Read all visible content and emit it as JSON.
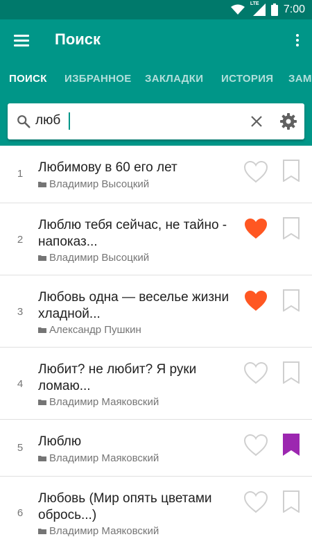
{
  "status_bar": {
    "time": "7:00",
    "network_label": "LTE"
  },
  "app_bar": {
    "title": "Поиск"
  },
  "tabs": [
    {
      "label": "ПОИСК",
      "active": true
    },
    {
      "label": "ИЗБРАННОЕ",
      "active": false
    },
    {
      "label": "ЗАКЛАДКИ",
      "active": false
    },
    {
      "label": "ИСТОРИЯ",
      "active": false
    },
    {
      "label": "ЗАМ",
      "active": false
    }
  ],
  "search": {
    "value": "люб"
  },
  "results": [
    {
      "number": "1",
      "title": "Любимову в 60 его лет",
      "author": "Владимир Высоцкий",
      "favorite": false,
      "bookmarked": false
    },
    {
      "number": "2",
      "title": "Люблю тебя сейчас, не тайно - напоказ...",
      "author": "Владимир Высоцкий",
      "favorite": true,
      "bookmarked": false
    },
    {
      "number": "3",
      "title": "Любовь одна — веселье жизни хладной...",
      "author": "Александр Пушкин",
      "favorite": true,
      "bookmarked": false
    },
    {
      "number": "4",
      "title": "Любит? не любит? Я руки ломаю...",
      "author": "Владимир Маяковский",
      "favorite": false,
      "bookmarked": false
    },
    {
      "number": "5",
      "title": "Люблю",
      "author": "Владимир Маяковский",
      "favorite": false,
      "bookmarked": true
    },
    {
      "number": "6",
      "title": "Любовь (Мир опять цветами обрось...)",
      "author": "Владимир Маяковский",
      "favorite": false,
      "bookmarked": false
    }
  ],
  "colors": {
    "primary": "#009688",
    "primary_dark": "#00796b",
    "favorite_active": "#ff5722",
    "bookmark_active": "#9c27b0",
    "icon_inactive": "#cfcfcf"
  }
}
